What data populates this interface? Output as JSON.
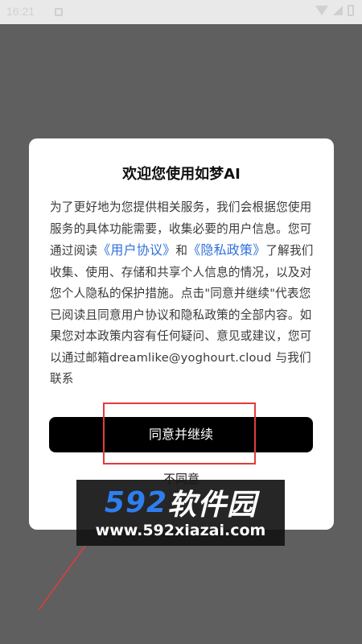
{
  "status_bar": {
    "time": "16:21"
  },
  "dialog": {
    "title": "欢迎您使用如梦AI",
    "body_part1": "为了更好地为您提供相关服务，我们会根据您使用服务的具体功能需要，收集必要的用户信息。您可通过阅读",
    "link_user_agreement": "《用户协议》",
    "body_and": "和",
    "link_privacy_policy": "《隐私政策》",
    "body_part2": "了解我们收集、使用、存储和共享个人信息的情况，以及对您个人隐私的保护措施。点击\"同意并继续\"代表您已阅读且同意用户协议和隐私政策的全部内容。如果您对本政策内容有任何疑问、意见或建议，您可以通过邮箱dreamlike@yoghourt.cloud 与我们联系",
    "agree_label": "同意并继续",
    "disagree_label": "不同意"
  },
  "watermark": {
    "brand_number": "592",
    "brand_text": "软件园",
    "url": "www.592xiazai.com"
  },
  "colors": {
    "overlay": "#5f5f5f",
    "link": "#2f72d9",
    "button_bg": "#000000",
    "highlight": "#e23b3b",
    "watermark_accent": "#2d7ff0"
  }
}
